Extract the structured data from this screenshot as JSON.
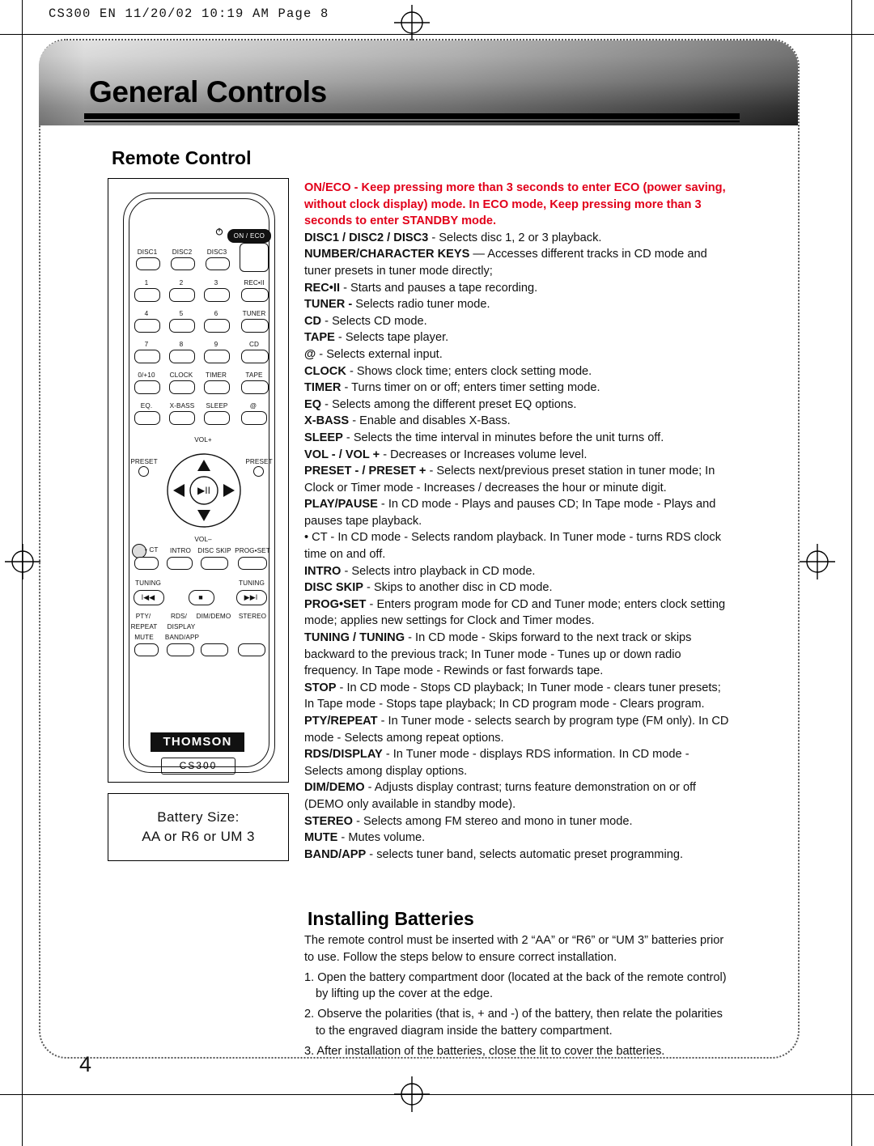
{
  "print_header": "CS300 EN  11/20/02  10:19 AM  Page 8",
  "page_title": "General Controls",
  "page_number": "4",
  "sections": {
    "remote_control_heading": "Remote Control",
    "installing_batteries_heading": "Installing Batteries"
  },
  "battery_box": {
    "line1": "Battery Size:",
    "line2": "AA  or  R6  or  UM 3"
  },
  "remote": {
    "brand": "THOMSON",
    "model": "CS300",
    "on_eco": "ON / ECO",
    "disc_row": [
      "DISC1",
      "DISC2",
      "DISC3"
    ],
    "keypad": [
      "1",
      "2",
      "3",
      "4",
      "5",
      "6",
      "7",
      "8",
      "9",
      "0/+10"
    ],
    "right_column": [
      "REC•II",
      "TUNER",
      "CD",
      "TAPE"
    ],
    "row_clock": [
      "CLOCK",
      "TIMER"
    ],
    "row_eq": [
      "EQ.",
      "X-BASS",
      "SLEEP",
      "@"
    ],
    "vol_up": "VOL+",
    "vol_down": "VOL–",
    "preset_left": "PRESET",
    "preset_right": "PRESET",
    "ct": "• CT",
    "intro": "INTRO",
    "disc_skip": "DISC SKIP",
    "prog_set": "PROG•SET",
    "tuning_left": "TUNING",
    "tuning_right": "TUNING",
    "pty": "PTY/",
    "repeat": "REPEAT",
    "rds": "RDS/",
    "display": "DISPLAY",
    "dim_demo": "DIM/DEMO",
    "stereo": "STEREO",
    "mute": "MUTE",
    "band_app": "BAND/APP",
    "play_pause_glyph": "▶II",
    "stop_glyph": "■",
    "prev_glyph": "I◀◀",
    "next_glyph": "▶▶I"
  },
  "descriptions": [
    {
      "id": "on-eco",
      "term": "ON/ECO",
      "term_red": true,
      "text": " - Keep pressing more than 3 seconds to enter ECO (power saving, without clock display) mode. In ECO mode, Keep pressing more than 3 seconds  to enter STANDBY mode."
    },
    {
      "id": "disc",
      "term": "DISC1 / DISC2 / DISC3",
      "term_red": false,
      "text": " -  Selects disc 1, 2 or 3 playback."
    },
    {
      "id": "number-keys",
      "term": "NUMBER/CHARACTER KEYS",
      "term_red": false,
      "text": " — Accesses different tracks in CD mode and tuner presets in tuner mode directly;"
    },
    {
      "id": "rec",
      "term": "REC•II",
      "term_red": false,
      "text": " - Starts and pauses a tape recording."
    },
    {
      "id": "tuner",
      "term": "TUNER -",
      "term_red": false,
      "text": " Selects radio tuner mode."
    },
    {
      "id": "cd",
      "term": "CD",
      "term_red": false,
      "text": " - Selects CD mode."
    },
    {
      "id": "tape",
      "term": "TAPE",
      "term_red": false,
      "text": " - Selects tape player."
    },
    {
      "id": "at",
      "term": "@",
      "term_red": false,
      "text": " - Selects external input."
    },
    {
      "id": "clock",
      "term": "CLOCK",
      "term_red": false,
      "text": " - Shows clock time; enters clock setting mode."
    },
    {
      "id": "timer",
      "term": "TIMER",
      "term_red": false,
      "text": " - Turns timer on or off; enters timer setting mode."
    },
    {
      "id": "eq",
      "term": "EQ",
      "term_red": false,
      "text": " - Selects among the different preset EQ options."
    },
    {
      "id": "x-bass",
      "term": "X-BASS",
      "term_red": false,
      "text": " - Enable and disables X-Bass."
    },
    {
      "id": "sleep",
      "term": "SLEEP",
      "term_red": false,
      "text": " - Selects the time interval in minutes before the unit turns off."
    },
    {
      "id": "vol",
      "term": "VOL -        / VOL +",
      "term_red": false,
      "text": "           - Decreases or Increases volume level."
    },
    {
      "id": "preset",
      "term": "PRESET -        / PRESET +",
      "term_red": false,
      "text": "        - Selects next/previous preset station in tuner mode; In Clock or Timer mode - Increases / decreases the hour or minute digit."
    },
    {
      "id": "play-pause",
      "term": "PLAY/PAUSE",
      "term_red": false,
      "text": "                   - In CD mode - Plays and pauses CD; In Tape mode - Plays and pauses tape playback."
    },
    {
      "id": "ct",
      "term": "",
      "term_red": false,
      "text": "• CT - In CD mode - Selects random playback. In Tuner mode - turns RDS clock time on and off."
    },
    {
      "id": "intro",
      "term": "INTRO",
      "term_red": false,
      "text": " - Selects intro playback in CD mode."
    },
    {
      "id": "disc-skip",
      "term": "DISC SKIP",
      "term_red": false,
      "text": " - Skips to another disc in CD mode."
    },
    {
      "id": "prog-set",
      "term": "PROG•SET",
      "term_red": false,
      "text": " - Enters  program mode for CD and Tuner mode; enters clock setting mode; applies new settings for Clock and Timer modes."
    },
    {
      "id": "tuning",
      "term": "TUNING           / TUNING",
      "term_red": false,
      "text": "         - In CD mode - Skips forward to the next track or skips backward to the previous track; In Tuner mode - Tunes up or down radio frequency. In Tape mode - Rewinds or fast forwards tape."
    },
    {
      "id": "stop",
      "term": "STOP",
      "term_red": false,
      "text": " - In CD mode - Stops CD playback; In Tuner mode - clears tuner presets; In Tape mode - Stops tape playback; In CD program mode - Clears program."
    },
    {
      "id": "pty-repeat",
      "term": "PTY/REPEAT",
      "term_red": false,
      "text": " - In Tuner mode - selects search by program type (FM only). In CD mode - Selects among repeat options."
    },
    {
      "id": "rds-display",
      "term": "RDS/DISPLAY",
      "term_red": false,
      "text": " - In Tuner mode - displays RDS information. In CD mode - Selects among display options."
    },
    {
      "id": "dim-demo",
      "term": "DIM/DEMO",
      "term_red": false,
      "text": "  - Adjusts display contrast; turns feature demonstration on or off (DEMO only available in standby mode)."
    },
    {
      "id": "stereo",
      "term": "STEREO",
      "term_red": false,
      "text": " - Selects among FM stereo and mono in tuner mode."
    },
    {
      "id": "mute",
      "term": "MUTE",
      "term_red": false,
      "text": " - Mutes volume."
    },
    {
      "id": "band-app",
      "term": "BAND/APP",
      "term_red": false,
      "text": " - selects tuner band, selects automatic preset programming."
    }
  ],
  "installing_batteries": {
    "intro": "The remote control must be inserted with 2 “AA” or  “R6” or “UM 3” batteries prior to use. Follow the steps below to ensure correct installation.",
    "steps": [
      "1.  Open the battery compartment door (located at the back of the remote control) by lifting up the cover at the edge.",
      "2. Observe the polarities (that is, + and -) of the battery, then relate the polarities to the engraved diagram inside the battery compartment.",
      "3. After installation of the batteries, close the lit to cover the batteries."
    ]
  },
  "colors": {
    "accent_red": "#e2001a",
    "text": "#111111",
    "banner_dark": "#111111"
  }
}
